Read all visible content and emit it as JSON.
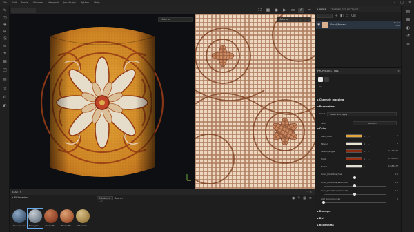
{
  "menu": [
    "File",
    "Edit",
    "Mode",
    "Window",
    "Viewport",
    "JavaScript",
    "Python",
    "Help"
  ],
  "toolbar": {
    "icons": [
      "frame-icon",
      "grid-icon",
      "camera-icon",
      "video-icon",
      "screen-icon",
      "paintbrush-icon",
      "pen-icon",
      "layout-icon"
    ]
  },
  "viewport3d": {
    "dropdown": "Material"
  },
  "viewport2d": {
    "dropdown": "Material"
  },
  "assets": {
    "title": "ASSETS",
    "library": "All libraries",
    "filter": "Substance (...)",
    "search": "Search",
    "items": [
      {
        "name": "Blue mosaic",
        "color_a": "#3d5570",
        "color_b": "#8ea9c4"
      },
      {
        "name": "Floral_Mos...",
        "color_a": "#6d7a86",
        "color_b": "#c7cdd4"
      },
      {
        "name": "Terracotta...",
        "color_a": "#8a3d24",
        "color_b": "#c77a52"
      },
      {
        "name": "Terracotta...",
        "color_a": "#a0512d",
        "color_b": "#dea276"
      },
      {
        "name": "Yellow mo...",
        "color_a": "#9c7c3f",
        "color_b": "#d9c08a"
      }
    ]
  },
  "rightpanel": {
    "tabs": [
      "LAYERS",
      "TEXTURE SET SETTINGS"
    ],
    "layer": {
      "name": "Floral_Mosaic",
      "mode": "Norm",
      "opacity": "100"
    },
    "properties_title": "PROPERTIES - FILL",
    "projection": "UV",
    "sections": {
      "channels": "Channels mapping",
      "parameters": "Parameters",
      "color": "Color",
      "damage": "Damage",
      "dirt": "Dirt",
      "roughness": "Roughness"
    },
    "preset_label": "Preset",
    "preset_value": "Select and Apply",
    "seed_label": "Seed",
    "seed_value": "Random",
    "color_params": [
      {
        "label": "Main_Color",
        "color": "#e4a43a",
        "value": "1"
      },
      {
        "label": "Flower",
        "color": "#e9e3d4",
        "value": "1"
      },
      {
        "label": "Flower_edges",
        "color": "#8a2a10",
        "value": "0.720044"
      },
      {
        "label": "Scroll",
        "color": "#9a2e12",
        "value": "0.702022"
      },
      {
        "label": "Frame",
        "color": "#e2ddd2",
        "value": "0.682272"
      }
    ],
    "sliders": [
      {
        "label": "Color_tonalities_hue",
        "value": "0.5",
        "fraction": 0.5
      },
      {
        "label": "Color_tonalities_saturation",
        "value": "0.5",
        "fraction": 0.5
      },
      {
        "label": "Color_tonalities_luminosity",
        "value": "0.5",
        "fraction": 0.5
      },
      {
        "label": "Add_Random_color",
        "value": "0",
        "fraction": 0.0
      }
    ]
  }
}
